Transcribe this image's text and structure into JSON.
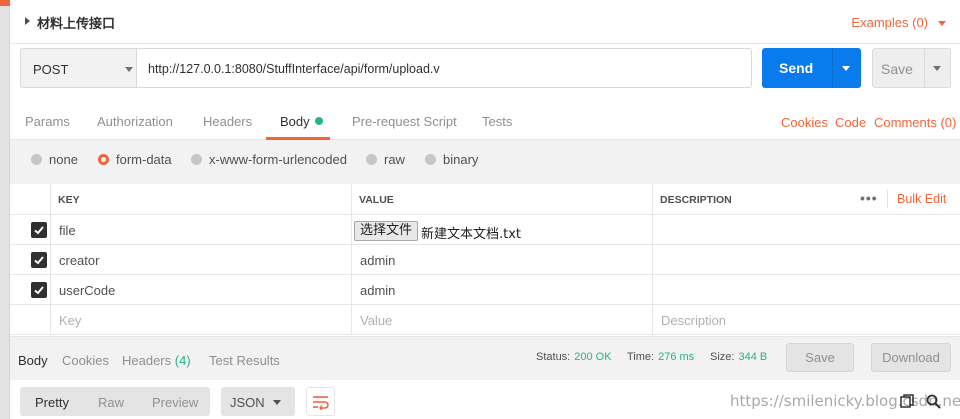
{
  "request": {
    "name": "材料上传接口",
    "examples_label": "Examples (0)",
    "method": "POST",
    "url": "http://127.0.0.1:8080/StuffInterface/api/form/upload.v",
    "send_label": "Send",
    "save_label": "Save"
  },
  "req_tabs": {
    "items": [
      "Params",
      "Authorization",
      "Headers",
      "Body",
      "Pre-request Script",
      "Tests"
    ],
    "active": "Body",
    "links": [
      "Cookies",
      "Code",
      "Comments (0)"
    ]
  },
  "body_types": {
    "options": [
      "none",
      "form-data",
      "x-www-form-urlencoded",
      "raw",
      "binary"
    ],
    "selected": "form-data"
  },
  "params_table": {
    "columns": [
      "KEY",
      "VALUE",
      "DESCRIPTION"
    ],
    "more_label": "•••",
    "bulk_edit_label": "Bulk Edit",
    "rows": [
      {
        "checked": true,
        "key": "file",
        "value_button": "选择文件",
        "value": "新建文本文档.txt",
        "description": ""
      },
      {
        "checked": true,
        "key": "creator",
        "value": "admin",
        "description": ""
      },
      {
        "checked": true,
        "key": "userCode",
        "value": "admin",
        "description": ""
      }
    ],
    "placeholders": {
      "key": "Key",
      "value": "Value",
      "description": "Description"
    }
  },
  "response": {
    "tabs": [
      "Body",
      "Cookies",
      "Headers",
      "Test Results"
    ],
    "headers_count": "(4)",
    "active_tab": "Body",
    "status_label": "Status:",
    "status_value": "200 OK",
    "time_label": "Time:",
    "time_value": "276 ms",
    "size_label": "Size:",
    "size_value": "344 B",
    "save_label": "Save",
    "download_label": "Download",
    "view_modes": [
      "Pretty",
      "Raw",
      "Preview"
    ],
    "active_view": "Pretty",
    "format": "JSON"
  },
  "watermark": "https://smilenicky.blog.csdn.net",
  "colors": {
    "accent": "#f0643a",
    "send_blue": "#097bed",
    "success_green": "#26b47f"
  },
  "icons": [
    "chevron-right-icon",
    "chevron-down-icon",
    "checkbox-checked-icon",
    "more-horizontal-icon",
    "wrap-lines-icon",
    "copy-icon",
    "search-icon"
  ]
}
